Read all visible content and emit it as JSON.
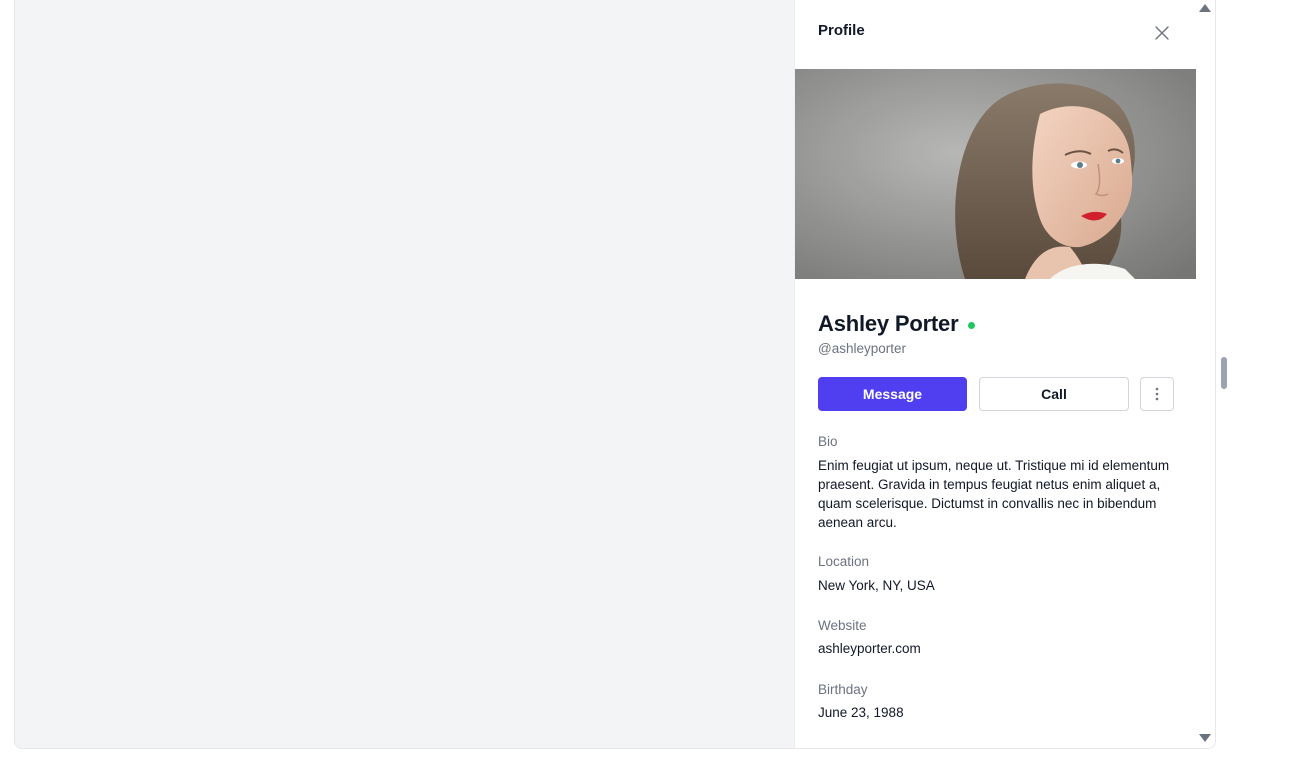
{
  "panel": {
    "title": "Profile",
    "close_icon": "close-icon"
  },
  "profile": {
    "photo_alt": "Ashley Porter",
    "name": "Ashley Porter",
    "status_color": "#22c55e",
    "handle": "@ashleyporter"
  },
  "actions": {
    "message_label": "Message",
    "call_label": "Call",
    "more_icon": "more-vertical-icon"
  },
  "fields": [
    {
      "label": "Bio",
      "value": "Enim feugiat ut ipsum, neque ut. Tristique mi id elementum praesent. Gravida in tempus feugiat netus enim aliquet a, quam scelerisque. Dictumst in convallis nec in bibendum aenean arcu."
    },
    {
      "label": "Location",
      "value": "New York, NY, USA"
    },
    {
      "label": "Website",
      "value": "ashleyporter.com"
    },
    {
      "label": "Birthday",
      "value": "June 23, 1988"
    }
  ],
  "colors": {
    "accent": "#4f3ff0",
    "backdrop": "#f3f4f6"
  }
}
